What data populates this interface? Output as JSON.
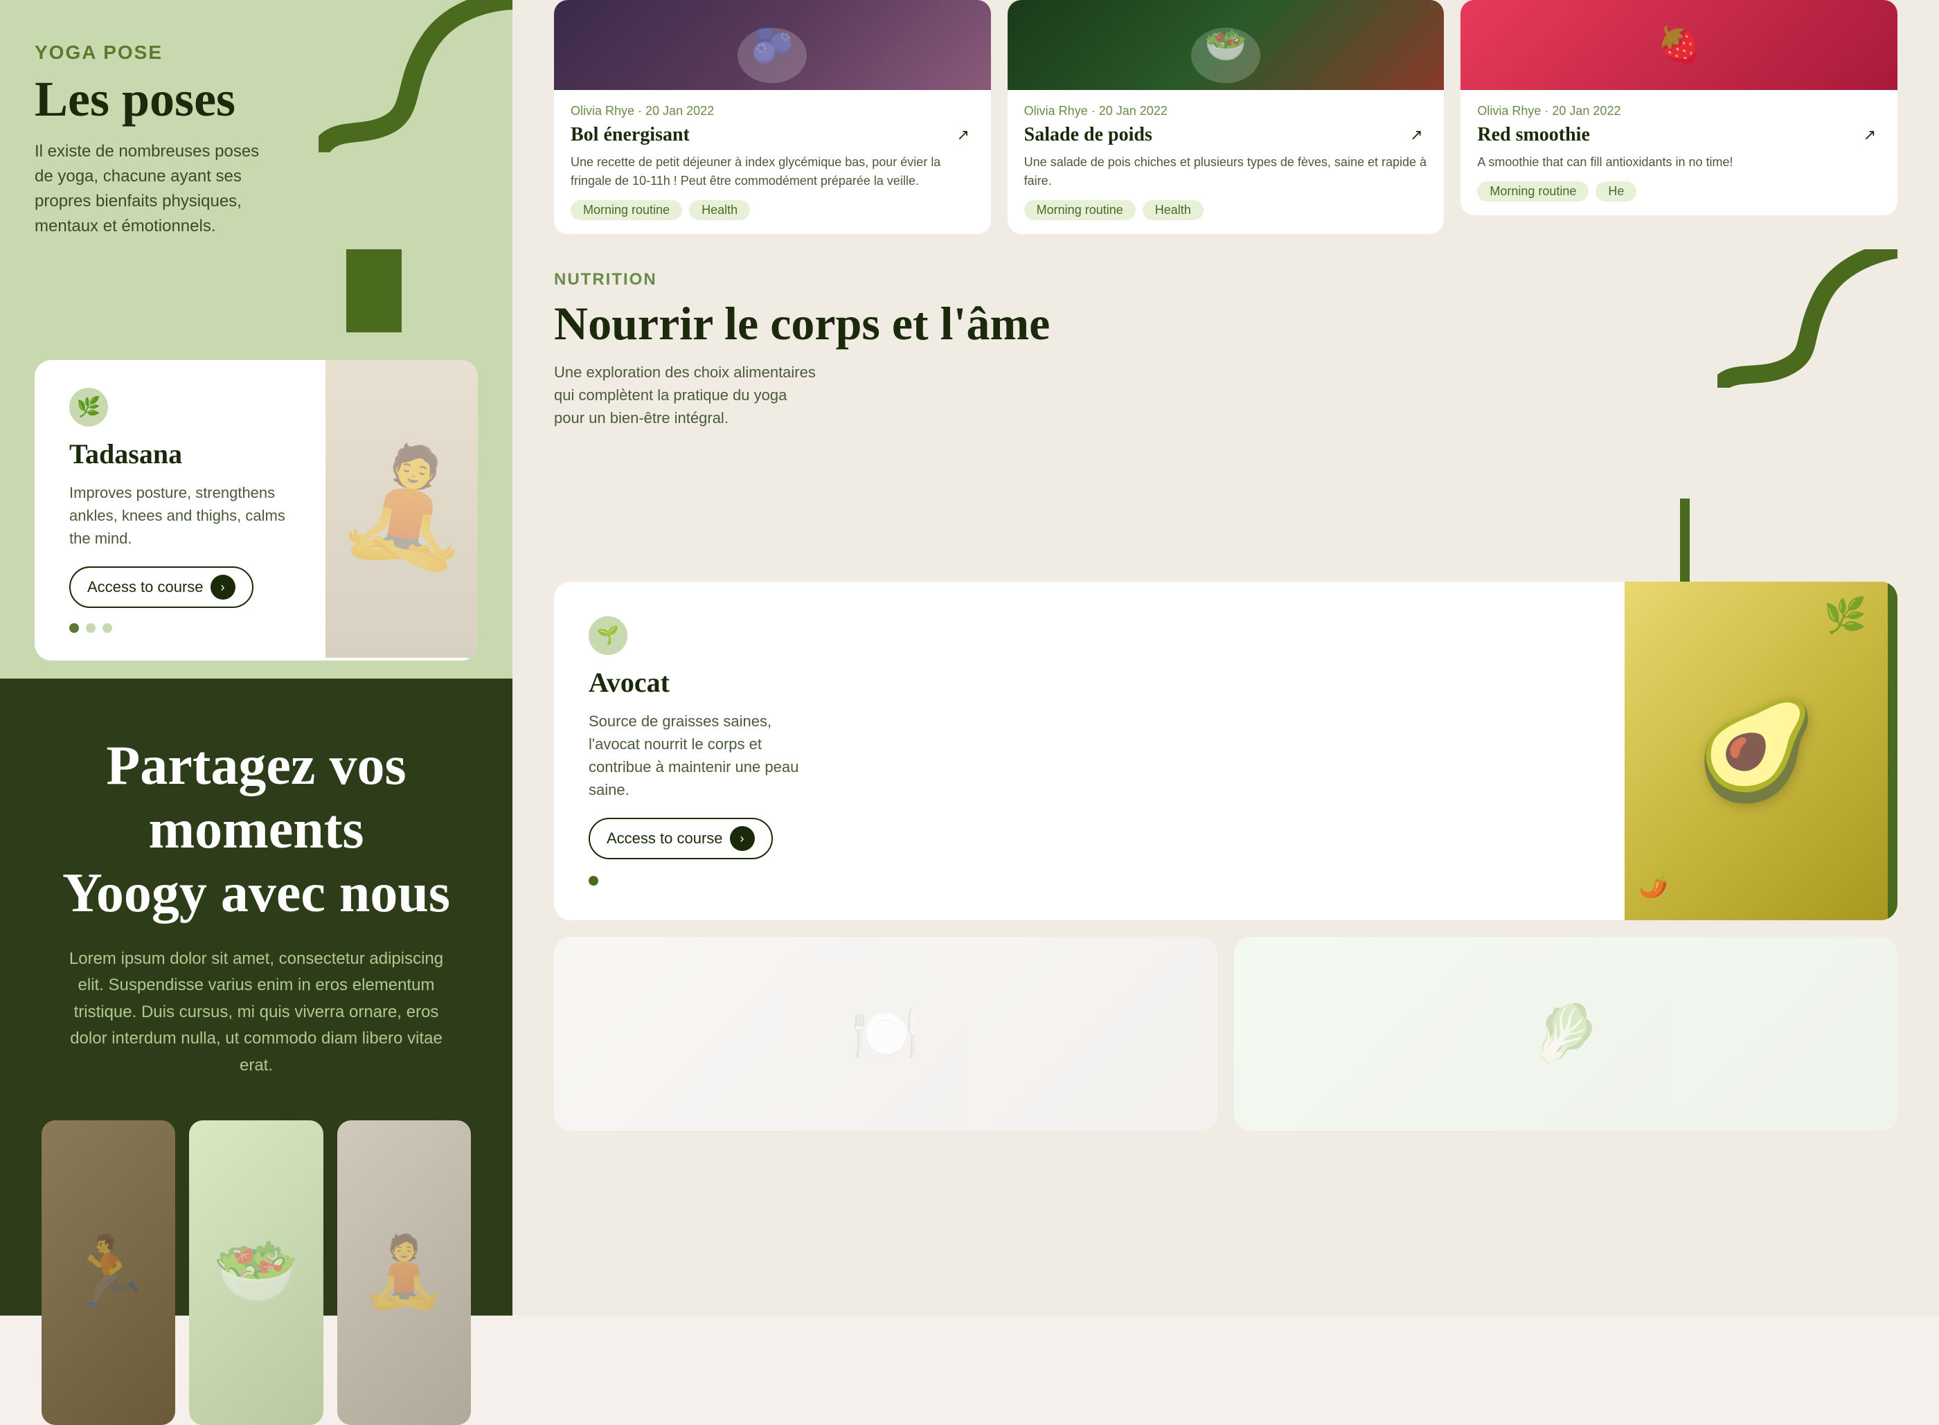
{
  "yoga": {
    "label": "YOGA POSE",
    "title": "Les poses",
    "description": "Il existe de nombreuses poses de yoga, chacune ayant ses propres bienfaits physiques, mentaux et émotionnels.",
    "pose": {
      "name": "Tadasana",
      "description": "Improves posture, strengthens ankles, knees and thighs, calms the mind.",
      "access_button": "Access to course",
      "icon": "🌿"
    }
  },
  "cta": {
    "title": "Partagez vos moments\nYoogy avec nous",
    "description": "Lorem ipsum dolor sit amet, consectetur adipiscing elit. Suspendisse varius enim in eros elementum tristique. Duis cursus, mi quis viverra ornare, eros dolor interdum nulla, ut commodo diam libero vitae erat."
  },
  "articles": {
    "meta_author": "Olivia Rhye",
    "meta_date": "20 Jan 2022",
    "items": [
      {
        "title": "Bol énergisant",
        "text": "Une recette de petit déjeuner à index glycémique bas, pour évier la fringale de 10-11h ! Peut être commodément préparée la veille.",
        "tags": [
          "Morning routine",
          "Health"
        ],
        "arrow": "↗"
      },
      {
        "title": "Salade de poids",
        "text": "Une salade de pois chiches et plusieurs types de fèves, saine et rapide à faire.",
        "tags": [
          "Morning routine",
          "Health"
        ],
        "arrow": "↗"
      },
      {
        "title": "Red smoothie",
        "text": "A smoothie that can fill antioxidants in no time!",
        "tags": [
          "Morning routine",
          "He"
        ],
        "arrow": "↗"
      }
    ]
  },
  "nutrition": {
    "label": "NUTRITION",
    "title": "Nourrir le corps et l'âme",
    "description": "Une exploration des choix alimentaires qui complètent la pratique du yoga pour un bien-être intégral."
  },
  "avocat": {
    "name": "Avocat",
    "description": "Source de graisses saines, l'avocat nourrit le corps et contribue à maintenir une peau saine.",
    "access_button": "Access to course",
    "icon": "🌱"
  },
  "icons": {
    "arrow_northeast": "↗",
    "arrow_right": "›"
  }
}
